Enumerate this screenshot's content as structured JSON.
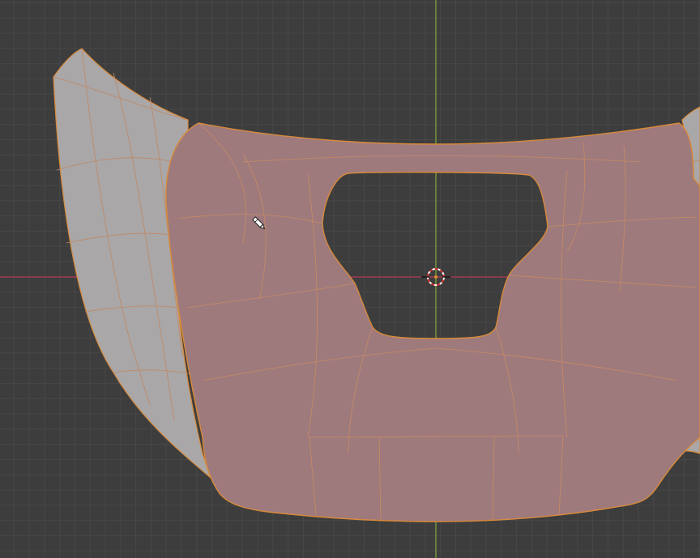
{
  "viewport": {
    "mode": "edit",
    "active_tool": "annotate",
    "axes": {
      "x_axis_color": "#b23a52",
      "y_axis_color": "#7ea33a"
    },
    "grid": {
      "visible": true,
      "background": "#3d3d3d",
      "line_color": "#474747"
    }
  },
  "mesh": {
    "selected_face_color": "#9e7a7d",
    "unselected_face_color": "#a9a7a8",
    "edge_color": "#d88a3a",
    "hole_color": "#3d3d3d"
  },
  "icons": {
    "cursor": "pencil-icon",
    "origin": "3d-cursor-icon"
  }
}
